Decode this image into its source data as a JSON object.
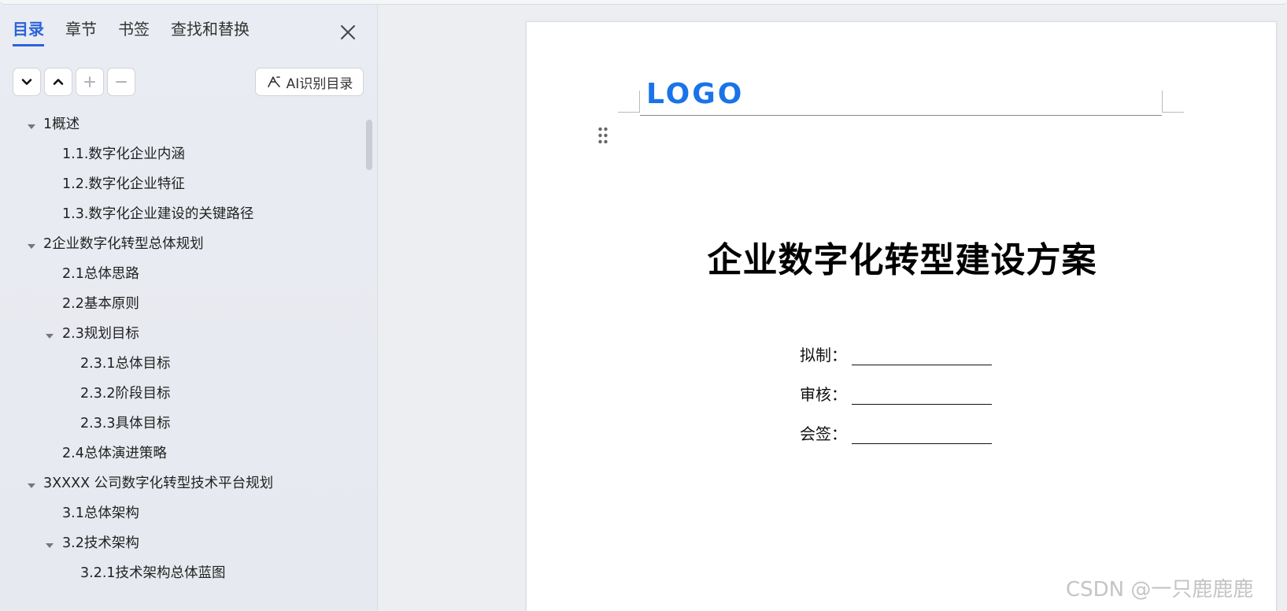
{
  "sidebar": {
    "tabs": [
      {
        "label": "目录",
        "active": true
      },
      {
        "label": "章节",
        "active": false
      },
      {
        "label": "书签",
        "active": false
      },
      {
        "label": "查找和替换",
        "active": false
      }
    ],
    "ai_button_label": "AI识别目录",
    "toc": [
      {
        "label": "1概述",
        "level": 0,
        "expanded": true
      },
      {
        "label": "1.1.数字化企业内涵",
        "level": 1
      },
      {
        "label": "1.2.数字化企业特征",
        "level": 1
      },
      {
        "label": "1.3.数字化企业建设的关键路径",
        "level": 1
      },
      {
        "label": "2企业数字化转型总体规划",
        "level": 0,
        "expanded": true
      },
      {
        "label": "2.1总体思路",
        "level": 1
      },
      {
        "label": "2.2基本原则",
        "level": 1
      },
      {
        "label": "2.3规划目标",
        "level": 1,
        "expanded": true
      },
      {
        "label": "2.3.1总体目标",
        "level": 2
      },
      {
        "label": "2.3.2阶段目标",
        "level": 2
      },
      {
        "label": "2.3.3具体目标",
        "level": 2
      },
      {
        "label": "2.4总体演进策略",
        "level": 1
      },
      {
        "label": "3XXXX 公司数字化转型技术平台规划",
        "level": 0,
        "expanded": true
      },
      {
        "label": "3.1总体架构",
        "level": 1
      },
      {
        "label": "3.2技术架构",
        "level": 1,
        "expanded": true
      },
      {
        "label": "3.2.1技术架构总体蓝图",
        "level": 2
      }
    ]
  },
  "document": {
    "logo_text": "LOGO",
    "title": "企业数字化转型建设方案",
    "sign_fields": [
      {
        "label": "拟制："
      },
      {
        "label": "审核："
      },
      {
        "label": "会签："
      }
    ]
  },
  "watermark": "CSDN @一只鹿鹿鹿",
  "colors": {
    "accent": "#2b63d9",
    "logo": "#1a73e8"
  }
}
